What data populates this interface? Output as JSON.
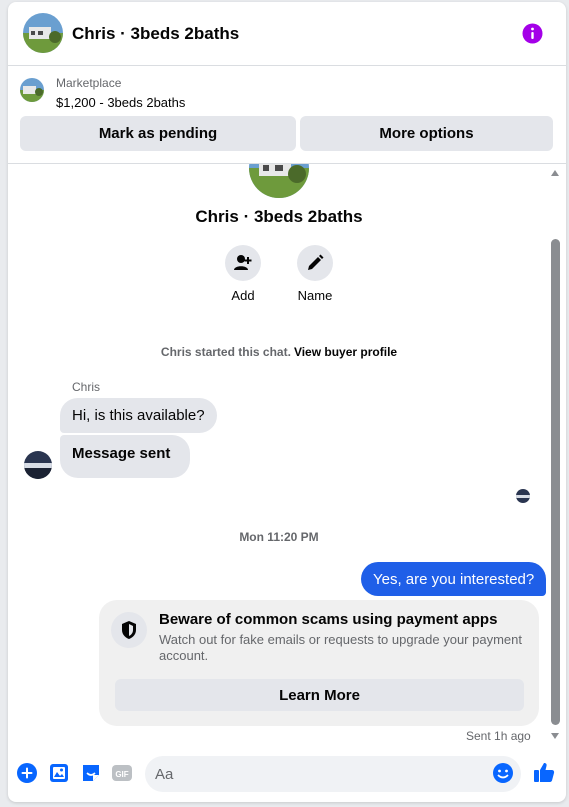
{
  "header": {
    "title": "Chris · 3beds 2baths"
  },
  "listing": {
    "label": "Marketplace",
    "price": "$1,200 - 3beds 2baths",
    "pending_label": "Mark as pending",
    "more_label": "More options"
  },
  "profile": {
    "name": "Chris · 3beds 2baths",
    "add_label": "Add",
    "name_label": "Name"
  },
  "chat": {
    "started_text": "Chris started this chat.",
    "started_link": "View buyer profile",
    "sender": "Chris",
    "msg1": "Hi, is this available?",
    "msg2": "Message sent",
    "timestamp": "Mon 11:20 PM",
    "reply": "Yes, are you interested?",
    "sent_status": "Sent 1h ago"
  },
  "warning": {
    "title": "Beware of common scams using payment apps",
    "body": "Watch out for fake emails or requests to upgrade your payment account.",
    "button": "Learn More"
  },
  "composer": {
    "placeholder": "Aa"
  },
  "icons": {
    "accent": "#0866ff",
    "info": "#a400e8",
    "outgoing": "#1f5fe8"
  }
}
